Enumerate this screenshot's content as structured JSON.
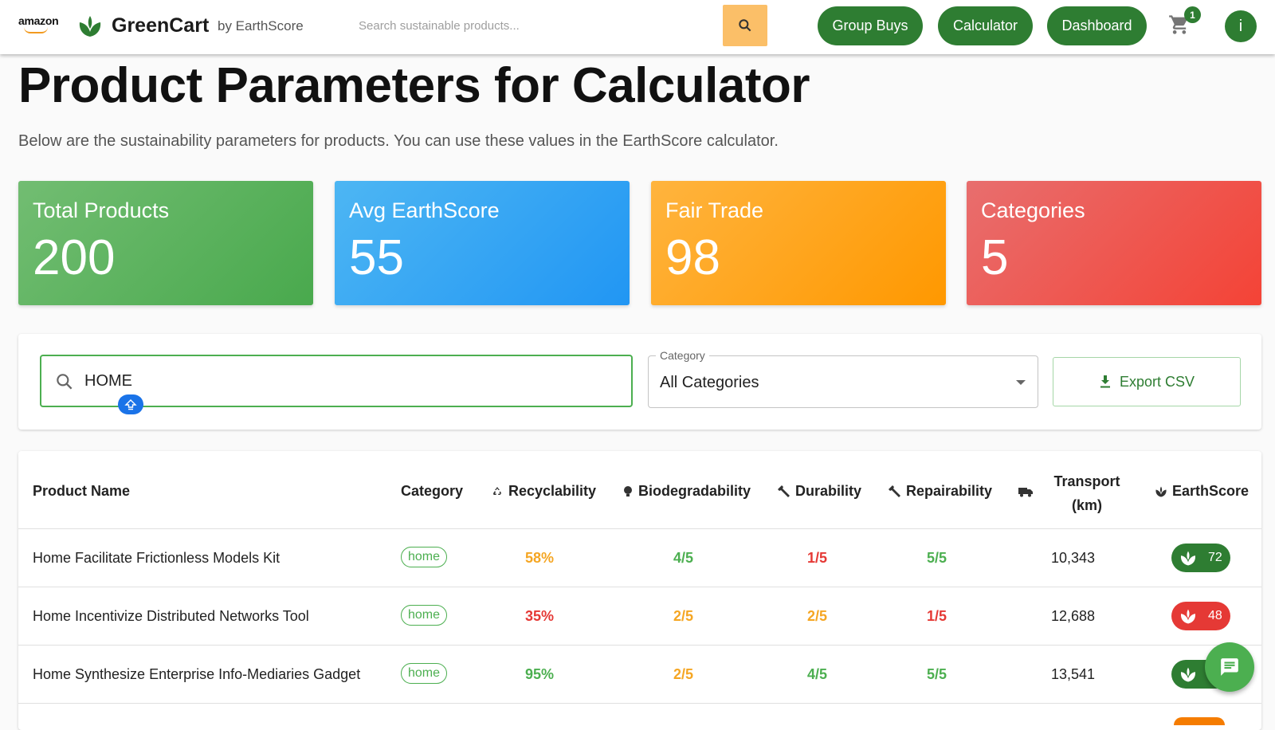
{
  "header": {
    "amazon_logo": "amazon",
    "brand_name": "GreenCart",
    "brand_by": "by EarthScore",
    "search_placeholder": "Search sustainable products...",
    "nav": [
      "Group Buys",
      "Calculator",
      "Dashboard"
    ],
    "cart_count": "1",
    "avatar_initial": "i"
  },
  "page": {
    "title": "Product Parameters for Calculator",
    "subtitle": "Below are the sustainability parameters for products. You can use these values in the EarthScore calculator."
  },
  "stats": [
    {
      "label": "Total Products",
      "value": "200",
      "color": "#4caf50"
    },
    {
      "label": "Avg EarthScore",
      "value": "55",
      "color": "#2196f3"
    },
    {
      "label": "Fair Trade",
      "value": "98",
      "color": "#ff9800"
    },
    {
      "label": "Categories",
      "value": "5",
      "color": "#f44336"
    }
  ],
  "filters": {
    "search_value": "HOME",
    "category_label": "Category",
    "category_value": "All Categories",
    "export_label": "Export CSV"
  },
  "table": {
    "headers": {
      "name": "Product Name",
      "category": "Category",
      "recyclability": "Recyclability",
      "biodegradability": "Biodegradability",
      "durability": "Durability",
      "repairability": "Repairability",
      "transport_line1": "Transport",
      "transport_line2": "(km)",
      "earthscore": "EarthScore"
    },
    "rows": [
      {
        "name": "Home Facilitate Frictionless Models Kit",
        "category": "home",
        "recyclability": "58%",
        "biodegradability": "4/5",
        "durability": "1/5",
        "repairability": "5/5",
        "transport": "10,343",
        "earthscore": "72"
      },
      {
        "name": "Home Incentivize Distributed Networks Tool",
        "category": "home",
        "recyclability": "35%",
        "biodegradability": "2/5",
        "durability": "2/5",
        "repairability": "1/5",
        "transport": "12,688",
        "earthscore": "48"
      },
      {
        "name": "Home Synthesize Enterprise Info-Mediaries Gadget",
        "category": "home",
        "recyclability": "95%",
        "biodegradability": "2/5",
        "durability": "4/5",
        "repairability": "5/5",
        "transport": "13,541",
        "earthscore": ""
      }
    ]
  },
  "colors": {
    "primary_green": "#2e7d32",
    "good": "#4caf50",
    "medium": "#f5a623",
    "bad": "#e53935"
  }
}
